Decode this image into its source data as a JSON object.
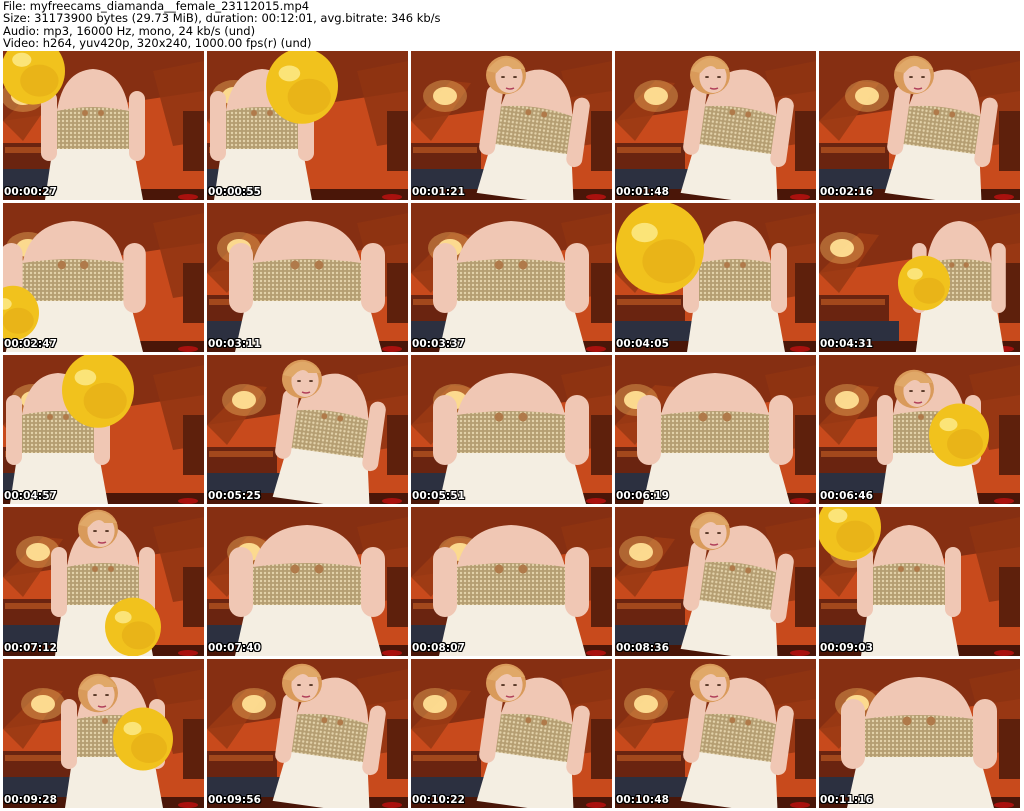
{
  "header": {
    "file": "File: myfreecams_diamanda__female_23112015.mp4",
    "size": "Size: 31173900 bytes (29.73 MiB), duration: 00:12:01, avg.bitrate: 346 kb/s",
    "audio": "Audio: mp3, 16000 Hz, mono, 24 kb/s (und)",
    "video": "Video: h264, yuv420p, 320x240, 1000.00 fps(r) (und)"
  },
  "thumbnails": [
    {
      "time": "00:00:27",
      "scene": "balloon-left"
    },
    {
      "time": "00:00:55",
      "scene": "balloon-right"
    },
    {
      "time": "00:01:21",
      "scene": "lean"
    },
    {
      "time": "00:01:48",
      "scene": "lean"
    },
    {
      "time": "00:02:16",
      "scene": "lean"
    },
    {
      "time": "00:02:47",
      "scene": "closeup-balloon"
    },
    {
      "time": "00:03:11",
      "scene": "closeup"
    },
    {
      "time": "00:03:37",
      "scene": "closeup"
    },
    {
      "time": "00:04:05",
      "scene": "balloon-big"
    },
    {
      "time": "00:04:31",
      "scene": "balloon-small"
    },
    {
      "time": "00:04:57",
      "scene": "balloon-right"
    },
    {
      "time": "00:05:25",
      "scene": "lean"
    },
    {
      "time": "00:05:51",
      "scene": "closeup"
    },
    {
      "time": "00:06:19",
      "scene": "closeup"
    },
    {
      "time": "00:06:46",
      "scene": "balloon-face"
    },
    {
      "time": "00:07:12",
      "scene": "balloon-bottom"
    },
    {
      "time": "00:07:40",
      "scene": "closeup"
    },
    {
      "time": "00:08:07",
      "scene": "closeup"
    },
    {
      "time": "00:08:36",
      "scene": "lean"
    },
    {
      "time": "00:09:03",
      "scene": "balloon-left"
    },
    {
      "time": "00:09:28",
      "scene": "balloon-face"
    },
    {
      "time": "00:09:56",
      "scene": "lean"
    },
    {
      "time": "00:10:22",
      "scene": "lean"
    },
    {
      "time": "00:10:48",
      "scene": "lean"
    },
    {
      "time": "00:11:16",
      "scene": "closeup"
    }
  ],
  "colors": {
    "wood": "#7a2a10",
    "wall": "#c84a1c",
    "lamp": "#ffe9a8",
    "dress": "#f4eee2",
    "sequin": "#c9b48a",
    "balloon": "#f1c21d",
    "skin": "#f0c7b4",
    "hair": "#d99a5a",
    "floor": "#2c3040",
    "timestamp": "#ffffff"
  }
}
